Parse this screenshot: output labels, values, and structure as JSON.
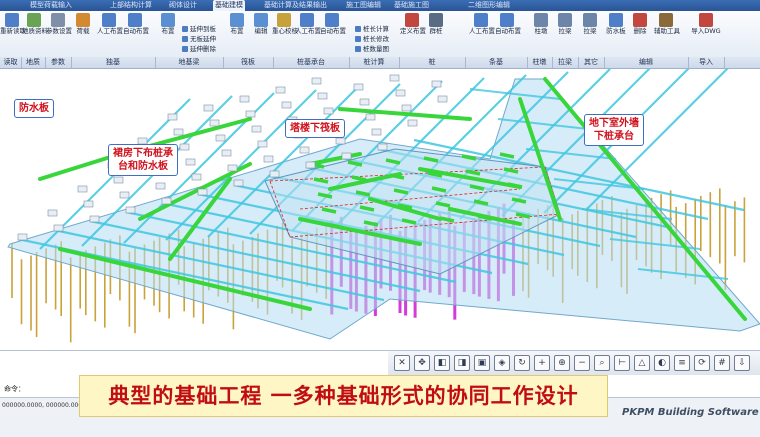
{
  "tabs": [
    {
      "label": "模型荷载输入",
      "active": false
    },
    {
      "label": "上部结构计算",
      "active": false
    },
    {
      "label": "砌体设计",
      "active": false
    },
    {
      "label": "基础建模",
      "active": true
    },
    {
      "label": "基础计算及结果输出",
      "active": false
    },
    {
      "label": "施工图编辑",
      "active": false
    },
    {
      "label": "基础施工图",
      "active": false
    },
    {
      "label": "二维图形编辑",
      "active": false
    }
  ],
  "ribbon": {
    "buttons": [
      {
        "label": "重新读取",
        "icon": "reload-icon",
        "color": "#4f7fc8"
      },
      {
        "label": "地质资料",
        "icon": "geology-icon",
        "color": "#6aa353"
      },
      {
        "label": "参数设置",
        "icon": "settings-icon",
        "color": "#7f8fa8"
      },
      {
        "label": "荷载",
        "icon": "load-icon",
        "color": "#d2892f"
      },
      {
        "label": "人工布置",
        "icon": "manual-place-icon",
        "color": "#4f7fc8"
      },
      {
        "label": "自动布置",
        "icon": "auto-place-icon",
        "color": "#4f7fc8"
      },
      {
        "label": "布置",
        "icon": "beam-place-icon",
        "color": "#5a8fd1"
      },
      {
        "label": "布置",
        "icon": "raft-place-icon",
        "color": "#5a8fd1"
      },
      {
        "label": "编辑",
        "icon": "raft-edit-icon",
        "color": "#5a8fd1"
      },
      {
        "label": "重心校核",
        "icon": "center-check-icon",
        "color": "#c8a13b"
      },
      {
        "label": "人工布置",
        "icon": "cap-manual-icon",
        "color": "#4f7fc8"
      },
      {
        "label": "自动布置",
        "icon": "cap-auto-icon",
        "color": "#4f7fc8"
      },
      {
        "label": "定义布置",
        "icon": "pile-define-icon",
        "color": "#c2473e"
      },
      {
        "label": "群桩",
        "icon": "pile-group-icon",
        "color": "#5a6b84"
      },
      {
        "label": "人工布置",
        "icon": "strip-manual-icon",
        "color": "#4f7fc8"
      },
      {
        "label": "自动布置",
        "icon": "strip-auto-icon",
        "color": "#4f7fc8"
      },
      {
        "label": "柱墩",
        "icon": "pier-icon",
        "color": "#6d85a8"
      },
      {
        "label": "拉梁",
        "icon": "tie-beam-icon",
        "color": "#6d85a8"
      },
      {
        "label": "拉梁",
        "icon": "tie-beam2-icon",
        "color": "#6d85a8"
      },
      {
        "label": "防水板",
        "icon": "waterproof-icon",
        "color": "#4f7fc8"
      },
      {
        "label": "删除",
        "icon": "delete-icon",
        "color": "#c2473e"
      },
      {
        "label": "辅助工具",
        "icon": "tools-icon",
        "color": "#8a6a3b"
      },
      {
        "label": "导入DWG",
        "icon": "import-dwg-icon",
        "color": "#c2473e"
      }
    ],
    "small_foundation_beam": [
      "延伸到板",
      "无板延伸",
      "延伸删除"
    ],
    "small_pile_calc": [
      "桩长计算",
      "桩长修改",
      "桩数量图"
    ],
    "groups": [
      {
        "label": "读取"
      },
      {
        "label": "地质"
      },
      {
        "label": "参数"
      },
      {
        "label": "独基"
      },
      {
        "label": "地基梁"
      },
      {
        "label": "筏板"
      },
      {
        "label": "桩基承台"
      },
      {
        "label": "桩计算"
      },
      {
        "label": "桩"
      },
      {
        "label": "条基"
      },
      {
        "label": "柱墩"
      },
      {
        "label": "拉梁"
      },
      {
        "label": "其它"
      },
      {
        "label": "编辑"
      },
      {
        "label": "导入"
      }
    ]
  },
  "callouts": {
    "waterproof": "防水板",
    "podium_line1": "裙房下布桩承",
    "podium_line2": "台和防水板",
    "tower": "塔楼下筏板",
    "wall_line1": "地下室外墙",
    "wall_line2": "下桩承台"
  },
  "command": {
    "label": "命令："
  },
  "status": {
    "coords": "000000.0000, 000000.0000"
  },
  "banner": {
    "text": "典型的基础工程 一多种基础形式的协同工作设计"
  },
  "brand": {
    "text": "PKPM Building Software"
  },
  "colors": {
    "beam": "#3fc7e0",
    "grade_beam": "#38d63a",
    "raft_edge": "#e02020",
    "pile": "#c9a23a",
    "pile_deep": "#d43bd8",
    "slab": "#a9d5ee"
  }
}
